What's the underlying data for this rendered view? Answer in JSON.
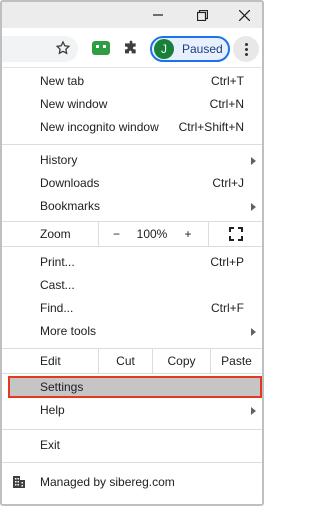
{
  "menu": {
    "new_tab": {
      "label": "New tab",
      "shortcut": "Ctrl+T"
    },
    "new_window": {
      "label": "New window",
      "shortcut": "Ctrl+N"
    },
    "new_incognito": {
      "label": "New incognito window",
      "shortcut": "Ctrl+Shift+N"
    },
    "history": {
      "label": "History"
    },
    "downloads": {
      "label": "Downloads",
      "shortcut": "Ctrl+J"
    },
    "bookmarks": {
      "label": "Bookmarks"
    },
    "zoom": {
      "label": "Zoom",
      "minus": "−",
      "value": "100%",
      "plus": "+"
    },
    "print": {
      "label": "Print...",
      "shortcut": "Ctrl+P"
    },
    "cast": {
      "label": "Cast..."
    },
    "find": {
      "label": "Find...",
      "shortcut": "Ctrl+F"
    },
    "more_tools": {
      "label": "More tools"
    },
    "edit": {
      "label": "Edit",
      "cut": "Cut",
      "copy": "Copy",
      "paste": "Paste"
    },
    "settings": {
      "label": "Settings"
    },
    "help": {
      "label": "Help"
    },
    "exit": {
      "label": "Exit"
    },
    "managed": {
      "label": "Managed by sibereg.com"
    }
  },
  "profile": {
    "initial": "J",
    "status": "Paused"
  },
  "colors": {
    "accent": "#1a73e8",
    "avatar": "#188038",
    "highlight_border": "#e2391f",
    "highlight_fill": "#c5c5c5"
  },
  "icons": [
    "minimize-icon",
    "restore-icon",
    "close-icon",
    "star-icon",
    "extension-app-icon",
    "puzzle-icon",
    "kebab-menu-icon",
    "fullscreen-icon",
    "building-icon"
  ]
}
